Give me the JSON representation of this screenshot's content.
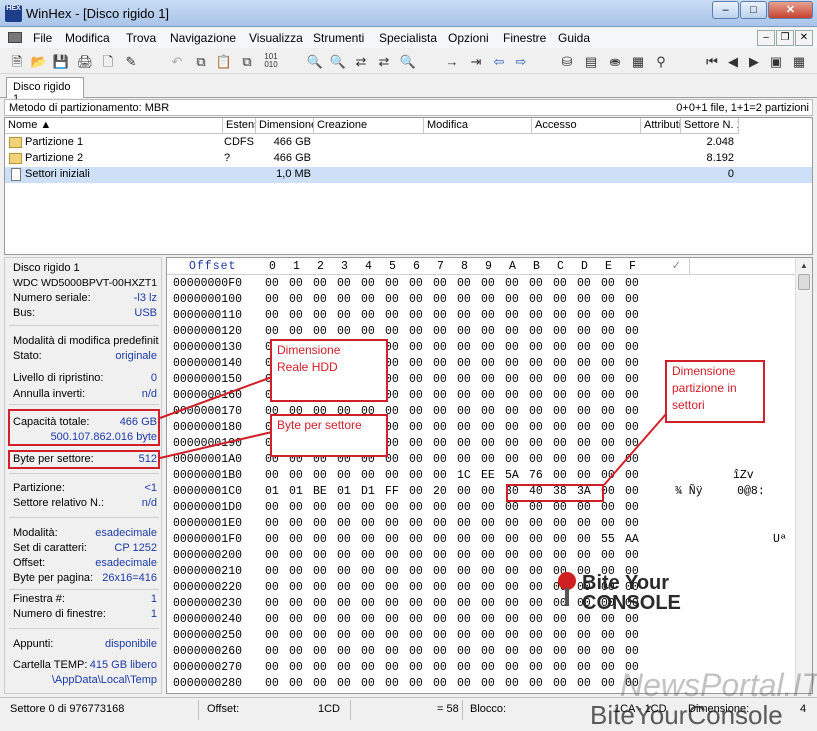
{
  "window": {
    "title": "WinHex - [Disco rigido 1]",
    "app_icon_text": "HEX"
  },
  "menu": [
    "File",
    "Modifica",
    "Trova",
    "Navigazione",
    "Visualizza",
    "Strumenti",
    "Specialista",
    "Opzioni",
    "Finestre",
    "Guida"
  ],
  "tab": {
    "label": "Disco rigido 1"
  },
  "partition_info": {
    "method": "Metodo di partizionamento: MBR",
    "summary": "0+0+1 file, 1+1=2 partizioni"
  },
  "file_list": {
    "columns": [
      "Nome ▲",
      "Estens.",
      "Dimensione",
      "Creazione",
      "Modifica",
      "Accesso",
      "Attributi",
      "Settore N. 1"
    ],
    "rows": [
      {
        "name": "Partizione 1",
        "ext": "CDFS",
        "size": "466 GB",
        "sector": "2.048"
      },
      {
        "name": "Partizione 2",
        "ext": "?",
        "size": "466 GB",
        "sector": "8.192"
      },
      {
        "name": "Settori iniziali",
        "ext": "",
        "size": "1,0 MB",
        "sector": "0"
      }
    ]
  },
  "left_panel": {
    "disk_name": "Disco rigido 1",
    "model": "WDC WD5000BPVT-00HXZT1",
    "serial_label": "Numero seriale:",
    "serial_value": "-l3 lz",
    "bus_label": "Bus:",
    "bus_value": "USB",
    "mode_label": "Modalità di modifica predefinita",
    "state_label": "Stato:",
    "state_value": "originale",
    "restore_label": "Livello di ripristino:",
    "restore_value": "0",
    "undo_label": "Annulla inverti:",
    "undo_value": "n/d",
    "capacity_label": "Capacità totale:",
    "capacity_value": "466 GB",
    "capacity_bytes": "500.107.862.016 byte",
    "bps_label": "Byte per settore:",
    "bps_value": "512",
    "partition_label": "Partizione:",
    "partition_value": "<1",
    "relsector_label": "Settore relativo N.:",
    "relsector_value": "n/d",
    "modality_label": "Modalità:",
    "modality_value": "esadecimale",
    "charset_label": "Set di caratteri:",
    "charset_value": "CP 1252",
    "offset_label": "Offset:",
    "offset_value": "esadecimale",
    "bpp_label": "Byte per pagina:",
    "bpp_value": "26x16=416",
    "window_label": "Finestra #:",
    "window_value": "1",
    "windows_label": "Numero di finestre:",
    "windows_value": "1",
    "clipboard_label": "Appunti:",
    "clipboard_value": "disponibile",
    "temp_label": "Cartella TEMP:",
    "temp_value": "415 GB libero",
    "temp_path": "\\AppData\\Local\\Temp"
  },
  "hex": {
    "header_offset": "Offset",
    "header_cols": [
      "0",
      "1",
      "2",
      "3",
      "4",
      "5",
      "6",
      "7",
      "8",
      "9",
      "A",
      "B",
      "C",
      "D",
      "E",
      "F"
    ],
    "rows": [
      {
        "off": "00000000F0",
        "b": [
          "00",
          "00",
          "00",
          "00",
          "00",
          "00",
          "00",
          "00",
          "00",
          "00",
          "00",
          "00",
          "00",
          "00",
          "00",
          "00"
        ],
        "t": ""
      },
      {
        "off": "0000000100",
        "b": [
          "00",
          "00",
          "00",
          "00",
          "00",
          "00",
          "00",
          "00",
          "00",
          "00",
          "00",
          "00",
          "00",
          "00",
          "00",
          "00"
        ],
        "t": ""
      },
      {
        "off": "0000000110",
        "b": [
          "00",
          "00",
          "00",
          "00",
          "00",
          "00",
          "00",
          "00",
          "00",
          "00",
          "00",
          "00",
          "00",
          "00",
          "00",
          "00"
        ],
        "t": ""
      },
      {
        "off": "0000000120",
        "b": [
          "00",
          "00",
          "00",
          "00",
          "00",
          "00",
          "00",
          "00",
          "00",
          "00",
          "00",
          "00",
          "00",
          "00",
          "00",
          "00"
        ],
        "t": ""
      },
      {
        "off": "0000000130",
        "b": [
          "00",
          "00",
          "00",
          "00",
          "00",
          "00",
          "00",
          "00",
          "00",
          "00",
          "00",
          "00",
          "00",
          "00",
          "00",
          "00"
        ],
        "t": ""
      },
      {
        "off": "0000000140",
        "b": [
          "00",
          "00",
          "00",
          "00",
          "00",
          "00",
          "00",
          "00",
          "00",
          "00",
          "00",
          "00",
          "00",
          "00",
          "00",
          "00"
        ],
        "t": ""
      },
      {
        "off": "0000000150",
        "b": [
          "00",
          "00",
          "00",
          "00",
          "00",
          "00",
          "00",
          "00",
          "00",
          "00",
          "00",
          "00",
          "00",
          "00",
          "00",
          "00"
        ],
        "t": ""
      },
      {
        "off": "0000000160",
        "b": [
          "00",
          "00",
          "00",
          "00",
          "00",
          "00",
          "00",
          "00",
          "00",
          "00",
          "00",
          "00",
          "00",
          "00",
          "00",
          "00"
        ],
        "t": ""
      },
      {
        "off": "0000000170",
        "b": [
          "00",
          "00",
          "00",
          "00",
          "00",
          "00",
          "00",
          "00",
          "00",
          "00",
          "00",
          "00",
          "00",
          "00",
          "00",
          "00"
        ],
        "t": ""
      },
      {
        "off": "0000000180",
        "b": [
          "00",
          "00",
          "00",
          "00",
          "00",
          "00",
          "00",
          "00",
          "00",
          "00",
          "00",
          "00",
          "00",
          "00",
          "00",
          "00"
        ],
        "t": ""
      },
      {
        "off": "0000000190",
        "b": [
          "00",
          "00",
          "00",
          "00",
          "00",
          "00",
          "00",
          "00",
          "00",
          "00",
          "00",
          "00",
          "00",
          "00",
          "00",
          "00"
        ],
        "t": ""
      },
      {
        "off": "00000001A0",
        "b": [
          "00",
          "00",
          "00",
          "00",
          "00",
          "00",
          "00",
          "00",
          "00",
          "00",
          "00",
          "00",
          "00",
          "00",
          "00",
          "00"
        ],
        "t": ""
      },
      {
        "off": "00000001B0",
        "b": [
          "00",
          "00",
          "00",
          "00",
          "00",
          "00",
          "00",
          "00",
          "1C",
          "EE",
          "5A",
          "76",
          "00",
          "00",
          "00",
          "00"
        ],
        "t": "îZv"
      },
      {
        "off": "00000001C0",
        "b": [
          "01",
          "01",
          "BE",
          "01",
          "D1",
          "FF",
          "00",
          "20",
          "00",
          "00",
          "30",
          "40",
          "38",
          "3A",
          "00",
          "00"
        ],
        "t": "¾ Ñÿ     0@8:"
      },
      {
        "off": "00000001D0",
        "b": [
          "00",
          "00",
          "00",
          "00",
          "00",
          "00",
          "00",
          "00",
          "00",
          "00",
          "00",
          "00",
          "00",
          "00",
          "00",
          "00"
        ],
        "t": ""
      },
      {
        "off": "00000001E0",
        "b": [
          "00",
          "00",
          "00",
          "00",
          "00",
          "00",
          "00",
          "00",
          "00",
          "00",
          "00",
          "00",
          "00",
          "00",
          "00",
          "00"
        ],
        "t": ""
      },
      {
        "off": "00000001F0",
        "b": [
          "00",
          "00",
          "00",
          "00",
          "00",
          "00",
          "00",
          "00",
          "00",
          "00",
          "00",
          "00",
          "00",
          "00",
          "55",
          "AA"
        ],
        "t": "Uª"
      },
      {
        "off": "0000000200",
        "b": [
          "00",
          "00",
          "00",
          "00",
          "00",
          "00",
          "00",
          "00",
          "00",
          "00",
          "00",
          "00",
          "00",
          "00",
          "00",
          "00"
        ],
        "t": ""
      },
      {
        "off": "0000000210",
        "b": [
          "00",
          "00",
          "00",
          "00",
          "00",
          "00",
          "00",
          "00",
          "00",
          "00",
          "00",
          "00",
          "00",
          "00",
          "00",
          "00"
        ],
        "t": ""
      },
      {
        "off": "0000000220",
        "b": [
          "00",
          "00",
          "00",
          "00",
          "00",
          "00",
          "00",
          "00",
          "00",
          "00",
          "00",
          "00",
          "00",
          "00",
          "00",
          "00"
        ],
        "t": ""
      },
      {
        "off": "0000000230",
        "b": [
          "00",
          "00",
          "00",
          "00",
          "00",
          "00",
          "00",
          "00",
          "00",
          "00",
          "00",
          "00",
          "00",
          "00",
          "00",
          "00"
        ],
        "t": ""
      },
      {
        "off": "0000000240",
        "b": [
          "00",
          "00",
          "00",
          "00",
          "00",
          "00",
          "00",
          "00",
          "00",
          "00",
          "00",
          "00",
          "00",
          "00",
          "00",
          "00"
        ],
        "t": ""
      },
      {
        "off": "0000000250",
        "b": [
          "00",
          "00",
          "00",
          "00",
          "00",
          "00",
          "00",
          "00",
          "00",
          "00",
          "00",
          "00",
          "00",
          "00",
          "00",
          "00"
        ],
        "t": ""
      },
      {
        "off": "0000000260",
        "b": [
          "00",
          "00",
          "00",
          "00",
          "00",
          "00",
          "00",
          "00",
          "00",
          "00",
          "00",
          "00",
          "00",
          "00",
          "00",
          "00"
        ],
        "t": ""
      },
      {
        "off": "0000000270",
        "b": [
          "00",
          "00",
          "00",
          "00",
          "00",
          "00",
          "00",
          "00",
          "00",
          "00",
          "00",
          "00",
          "00",
          "00",
          "00",
          "00"
        ],
        "t": ""
      },
      {
        "off": "0000000280",
        "b": [
          "00",
          "00",
          "00",
          "00",
          "00",
          "00",
          "00",
          "00",
          "00",
          "00",
          "00",
          "00",
          "00",
          "00",
          "00",
          "00"
        ],
        "t": ""
      }
    ]
  },
  "annotations": {
    "real_size": "Dimensione\nReale HDD",
    "bytes_per_sector": "Byte per settore",
    "partition_size": "Dimensione\npartizione in\nsettori"
  },
  "status": {
    "sector": "Settore 0 di 976773168",
    "offset_label": "Offset:",
    "offset_value": "1CD",
    "eq": "= 58",
    "block_label": "Blocco:",
    "block_value": "1CA - 1CD",
    "dim_label": "Dimensione:",
    "dim_value": "4"
  },
  "watermark": {
    "bite_line1": "Bite Your",
    "bite_line2": "CONSOLE",
    "portal": "NewsPortal.IT",
    "site": "BiteYourConsole"
  },
  "colors": {
    "annotation_red": "#d0202a",
    "value_blue": "#1c3aa6",
    "selection": "#cde0f7"
  }
}
